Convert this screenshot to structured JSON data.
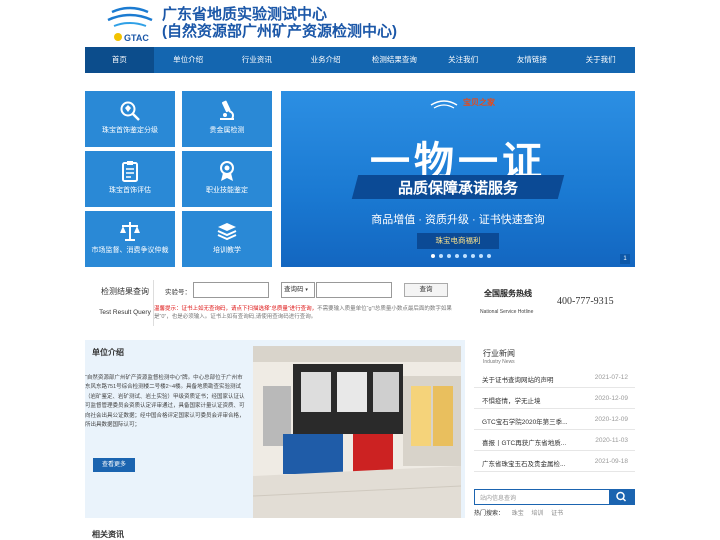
{
  "header": {
    "title_line1": "广东省地质实验测试中心",
    "title_line2": "(自然资源部广州矿产资源检测中心)",
    "logo_text": "GTAC"
  },
  "nav": {
    "items": [
      {
        "label": "首页",
        "active": true
      },
      {
        "label": "单位介绍",
        "active": false
      },
      {
        "label": "行业资讯",
        "active": false
      },
      {
        "label": "业务介绍",
        "active": false
      },
      {
        "label": "检测结果查询",
        "active": false
      },
      {
        "label": "关注我们",
        "active": false
      },
      {
        "label": "友情链接",
        "active": false
      },
      {
        "label": "关于我们",
        "active": false
      }
    ]
  },
  "services": [
    {
      "label": "珠宝首饰鉴定分级",
      "icon": "magnifier-diamond-icon"
    },
    {
      "label": "贵金属检测",
      "icon": "microscope-icon"
    },
    {
      "label": "珠宝首饰评估",
      "icon": "clipboard-icon"
    },
    {
      "label": "职业技能鉴定",
      "icon": "award-medal-icon"
    },
    {
      "label": "市场监督、消费争议仲裁",
      "icon": "scales-icon"
    },
    {
      "label": "培训教学",
      "icon": "books-icon"
    }
  ],
  "banner": {
    "headline": "一物一证",
    "strip": "品质保障承诺服务",
    "subline": "商品增值 · 资质升级 · 证书快速查询",
    "tag": "珠宝电商福利",
    "brand": "宝贝之家",
    "page": "1"
  },
  "query": {
    "title": "检测结果查询",
    "subtitle": "Test Result Query",
    "field_label": "实验号：",
    "select_value": "查询码",
    "button": "查询",
    "tip_warn": "温馨提示：证书上如无查询码，请点下扫描选择“总质量”进行查询，",
    "tip_rest": "不需要输入质量单位“g”!总质量小数点最后面的数字如果是“0”，也是必须输入。证书上如有查询码,请使用查询码进行查询。"
  },
  "hotline": {
    "title": "全国服务热线",
    "subtitle": "National Service Hotline",
    "number": "400-777-9315"
  },
  "about": {
    "title": "单位介绍",
    "text": "“自然资源部广州矿产资源监督检测中心”牌。中心总部位于广州市东风东路751号综合检测楼二号楼2~4楼。具备地质勘查实验测试（岩矿鉴定、岩矿测试、岩土实验）甲级资质证书；经国家认证认可监督管理委员会资质认定评审通过，具备国家计量认证资质、可向社会出具公证数据；经中国合格评定国家认可委员会评审合格，所出具数据国际认可；",
    "more": "查看更多"
  },
  "news": {
    "title": "行业新闻",
    "subtitle": "Industry News",
    "items": [
      {
        "title": "关于证书查询网站的声明",
        "date": "2021-07-12"
      },
      {
        "title": "不惧疫情，学无止境",
        "date": "2020-12-09"
      },
      {
        "title": "GTC宝石学院2020年第三季...",
        "date": "2020-12-09"
      },
      {
        "title": "喜报丨GTC再获广东省地质...",
        "date": "2020-11-03"
      },
      {
        "title": "广东省珠宝玉石及贵金属检...",
        "date": "2021-09-18"
      }
    ]
  },
  "search": {
    "placeholder": "站内信息查询",
    "hot_label": "热门搜索：",
    "hot_words": [
      "珠宝",
      "培训",
      "证书"
    ]
  },
  "related": {
    "title": "相关资讯"
  },
  "colors": {
    "brand_blue": "#1466b0",
    "tile_blue": "#2a89d6",
    "warning_red": "#d11111"
  }
}
